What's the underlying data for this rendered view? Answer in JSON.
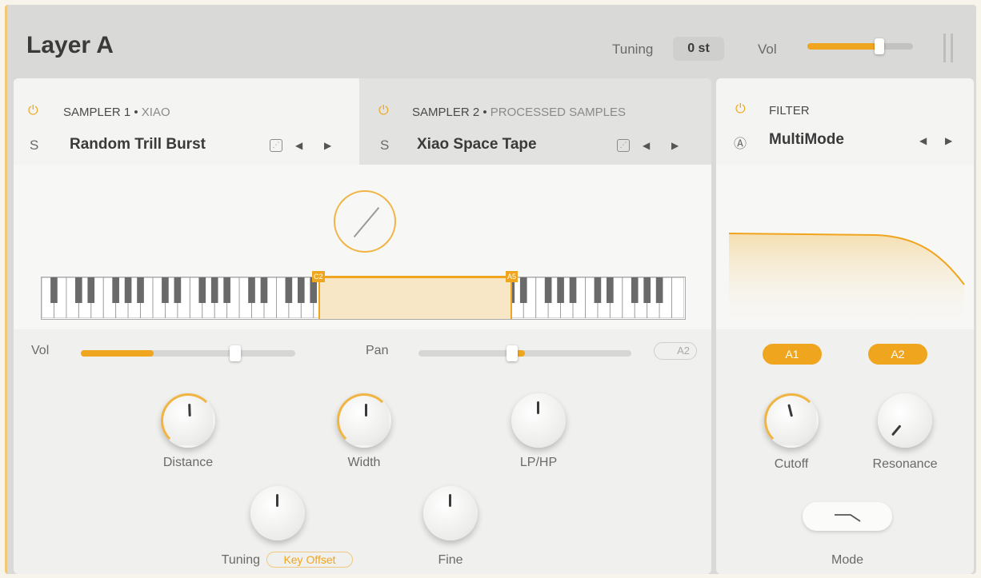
{
  "header": {
    "title": "Layer A",
    "tuning_label": "Tuning",
    "tuning_value": "0 st",
    "vol_label": "Vol",
    "vol_level": 0.68
  },
  "samplers": [
    {
      "title": "SAMPLER 1 •",
      "subtitle": "XIAO",
      "s_label": "S",
      "preset": "Random Trill Burst"
    },
    {
      "title": "SAMPLER 2 •",
      "subtitle": "PROCESSED SAMPLES",
      "s_label": "S",
      "preset": "Xiao Space Tape"
    }
  ],
  "keyboard": {
    "zone_low": "C2",
    "zone_high": "A5"
  },
  "controls": {
    "vol_label": "Vol",
    "vol_fill": 0.34,
    "vol_thumb": 0.72,
    "pan_label": "Pan",
    "pan_value": 0.44,
    "a2_toggle": "A2",
    "knobs": {
      "distance": "Distance",
      "width": "Width",
      "lphp": "LP/HP",
      "tuning": "Tuning",
      "fine": "Fine"
    },
    "tuning_mode": "Key Offset"
  },
  "filter": {
    "title": "FILTER",
    "mode_name": "MultiMode",
    "a1": "A1",
    "a2": "A2",
    "cutoff": "Cutoff",
    "resonance": "Resonance",
    "mode_label": "Mode"
  },
  "colors": {
    "accent": "#f0a51e",
    "panel": "#f0f0ee",
    "frame": "#d9d9d7"
  }
}
